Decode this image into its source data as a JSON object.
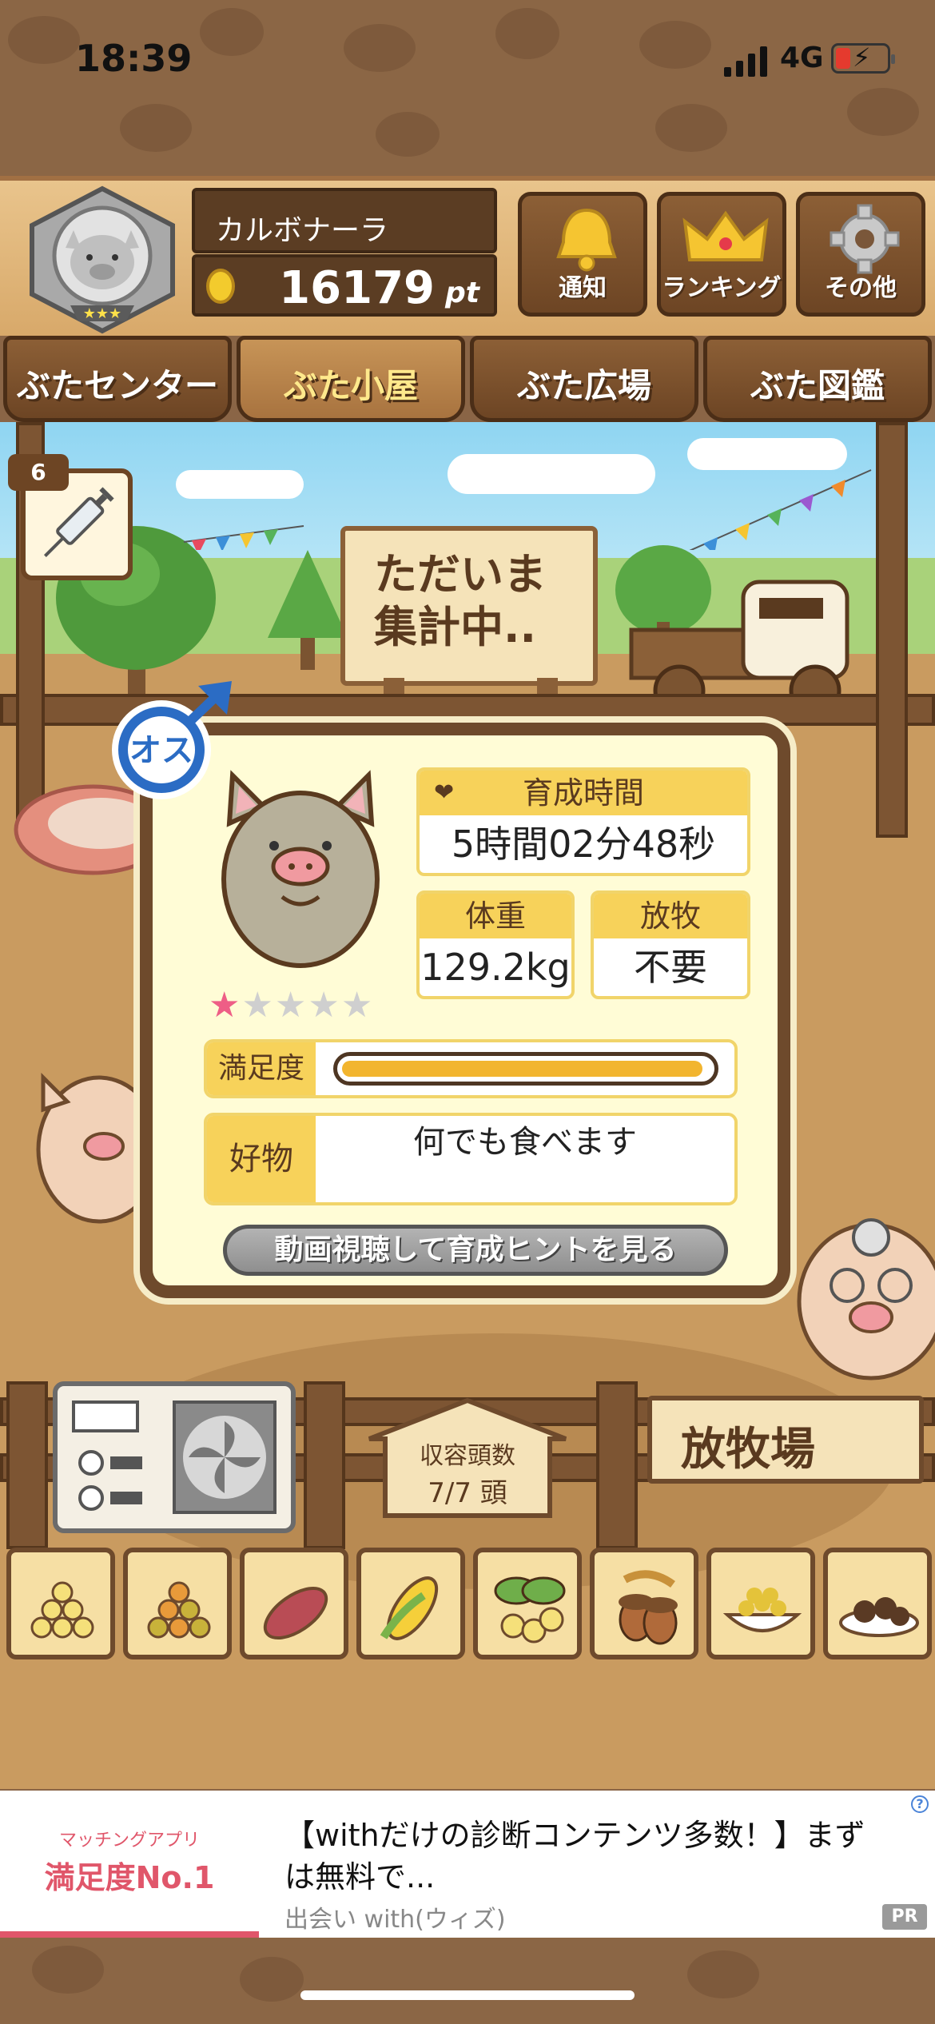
{
  "status_bar": {
    "time": "18:39",
    "network": "4G"
  },
  "header": {
    "player_name": "カルボナーラ",
    "points": "16179",
    "points_unit": "pt",
    "buttons": [
      {
        "label": "通知",
        "icon": "bell-icon"
      },
      {
        "label": "ランキング",
        "icon": "crown-icon"
      },
      {
        "label": "その他",
        "icon": "gear-icon"
      }
    ]
  },
  "nav_tabs": [
    {
      "label": "ぶたセンター",
      "active": false
    },
    {
      "label": "ぶた小屋",
      "active": true
    },
    {
      "label": "ぶた広場",
      "active": false
    },
    {
      "label": "ぶた図鑑",
      "active": false
    }
  ],
  "scene": {
    "sign_line1": "ただいま",
    "sign_line2": "集計中..",
    "syringe_count": "6"
  },
  "pig_card": {
    "gender": "オス",
    "rating": 1,
    "rating_max": 5,
    "grow_time_label": "育成時間",
    "grow_time_value": "5時間02分48秒",
    "weight_label": "体重",
    "weight_value": "129.2kg",
    "graze_label": "放牧",
    "graze_value": "不要",
    "satisfaction_label": "満足度",
    "satisfaction_level": 0.98,
    "favorite_label": "好物",
    "favorite_value": "何でも食べます",
    "hint_button": "動画視聴して育成ヒントを見る"
  },
  "barn": {
    "capacity_label": "収容頭数",
    "capacity_value": "7/7 頭",
    "pasture_sign": "放牧場"
  },
  "food_items": [
    "mixed-feed-icon",
    "grain-feed-icon",
    "sweet-potato-icon",
    "corn-icon",
    "soybean-icon",
    "acorn-icon",
    "bowl-feed-icon",
    "truffle-icon"
  ],
  "ad": {
    "logo_line1": "マッチングアプリ",
    "logo_line2": "満足度No.1",
    "title": "【withだけの診断コンテンツ多数！】まずは無料で...",
    "source": "出会い with(ウィズ)",
    "badge": "PR"
  },
  "colors": {
    "wood_dark": "#6e4a2c",
    "card_bg": "#fffcd6",
    "label_yellow": "#f7d25a",
    "satisfaction_fill": "#f2b52f",
    "star_on": "#ee5e86",
    "ad_pink": "#e0566a"
  }
}
